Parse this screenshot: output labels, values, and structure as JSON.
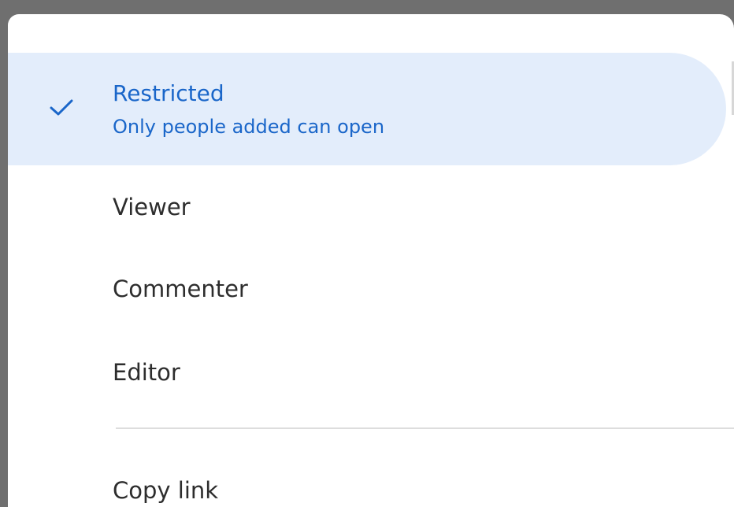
{
  "menu": {
    "selected": {
      "title": "Restricted",
      "subtitle": "Only people added can open",
      "icon": "checkmark-icon",
      "accent_color": "#1a66c9",
      "highlight_color": "#e3edfb"
    },
    "roles": [
      {
        "label": "Viewer"
      },
      {
        "label": "Commenter"
      },
      {
        "label": "Editor"
      }
    ],
    "copy_link_label": "Copy link"
  }
}
